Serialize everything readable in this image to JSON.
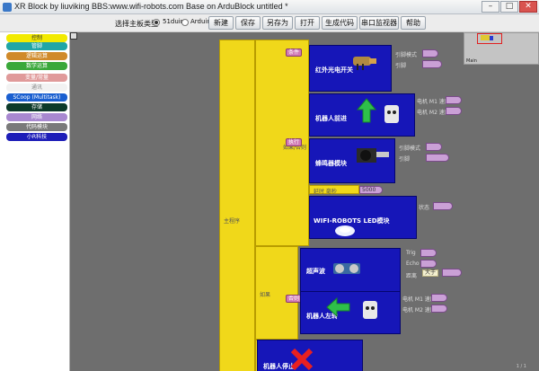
{
  "window": {
    "title": "XR Block by liuviking BBS:www.wifi-robots.com  Base on ArduBlock untitled *",
    "buttons": {
      "minimize": "–",
      "maximize": "□",
      "close": "✕"
    }
  },
  "toolbar": {
    "board_label": "选择主板类型",
    "radio_51duino": "51duino",
    "radio_arduino": "Arduino",
    "selected_board": "51duino",
    "buttons": [
      "新建",
      "保存",
      "另存为",
      "打开",
      "生成代码",
      "串口监视器",
      "帮助"
    ]
  },
  "sidebar": {
    "categories": [
      {
        "label": "控制",
        "color": "#f2ea00",
        "text": "#333333"
      },
      {
        "label": "管脚",
        "color": "#20a6a6",
        "text": "#ffffff"
      },
      {
        "label": "逻辑运算",
        "color": "#d08a2a",
        "text": "#ffffff"
      },
      {
        "label": "数学运算",
        "color": "#3aa83a",
        "text": "#ffffff"
      },
      {
        "label": "变量/常量",
        "color": "#e09a9a",
        "text": "#ffffff"
      },
      {
        "label": "通讯",
        "color": "#f2f2f2",
        "text": "#888888"
      },
      {
        "label": "SCoop (Multitask)",
        "color": "#1a5fd0",
        "text": "#ffffff"
      },
      {
        "label": "存储",
        "color": "#0c3a2a",
        "text": "#ffffff"
      },
      {
        "label": "网络",
        "color": "#a888d0",
        "text": "#ffffff"
      },
      {
        "label": "代码模块",
        "color": "#7a7a7a",
        "text": "#ffffff"
      },
      {
        "label": "小R科技",
        "color": "#1e1eb8",
        "text": "#ffffff"
      }
    ]
  },
  "canvas": {
    "minimap_label": "Main",
    "main_block_label": "主程序",
    "if_label_1": "如果/否则",
    "if_label_2": "如果",
    "cond_label": "条件",
    "then_label": "执行",
    "else_label": "否则",
    "blocks": {
      "ir_sensor": {
        "name": "红外光电开关",
        "p1": "引脚模式",
        "p2": "引脚"
      },
      "forward": {
        "name": "机器人前进",
        "p1": "电机 M1 速度",
        "p2": "电机 M2 速度"
      },
      "buzzer": {
        "name": "蜂鸣器模块",
        "p1": "引脚模式",
        "p2": "引脚"
      },
      "delay": {
        "label": "延时 毫秒",
        "value": "5000"
      },
      "wifi_led": {
        "name": "WIFI-ROBOTS LED模块",
        "p1": "状态"
      },
      "ultrasonic": {
        "name": "超声波",
        "p1": "Trig",
        "p2": "Echo",
        "p3": "距离",
        "cmp": "大于"
      },
      "turn_left": {
        "name": "机器人左转",
        "p1": "电机 M1 速度",
        "p2": "电机 M2 速度"
      },
      "stop": {
        "name": "机器人停止"
      }
    },
    "status": "1 / 1"
  }
}
